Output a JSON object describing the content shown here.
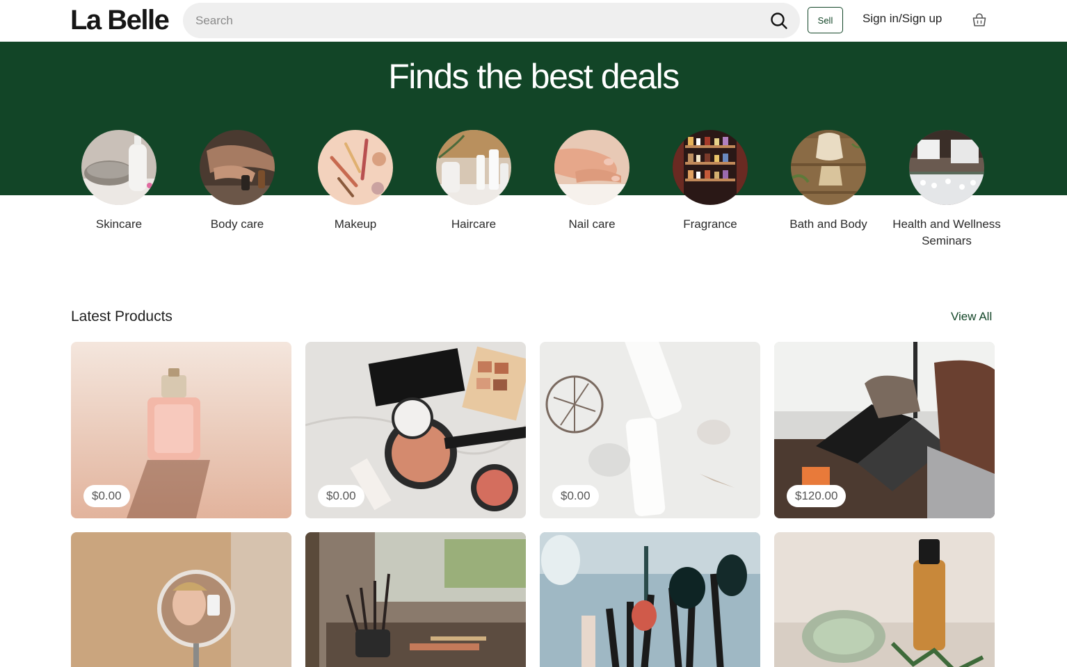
{
  "header": {
    "logo": "La Belle",
    "search_placeholder": "Search",
    "sell_label": "Sell",
    "signin_label": "Sign in/Sign up"
  },
  "hero": {
    "title": "Finds the best deals"
  },
  "categories": [
    {
      "label": "Skincare"
    },
    {
      "label": "Body care"
    },
    {
      "label": "Makeup"
    },
    {
      "label": "Haircare"
    },
    {
      "label": "Nail care"
    },
    {
      "label": "Fragrance"
    },
    {
      "label": "Bath and Body"
    },
    {
      "label": "Health and Wellness Seminars"
    }
  ],
  "latest": {
    "title": "Latest Products",
    "view_all": "View All",
    "products": [
      {
        "price": "$0.00"
      },
      {
        "price": "$0.00"
      },
      {
        "price": "$0.00"
      },
      {
        "price": "$120.00"
      },
      {
        "price": ""
      },
      {
        "price": ""
      },
      {
        "price": ""
      },
      {
        "price": ""
      }
    ]
  },
  "colors": {
    "brand_green": "#124527",
    "search_bg": "#efefef"
  }
}
